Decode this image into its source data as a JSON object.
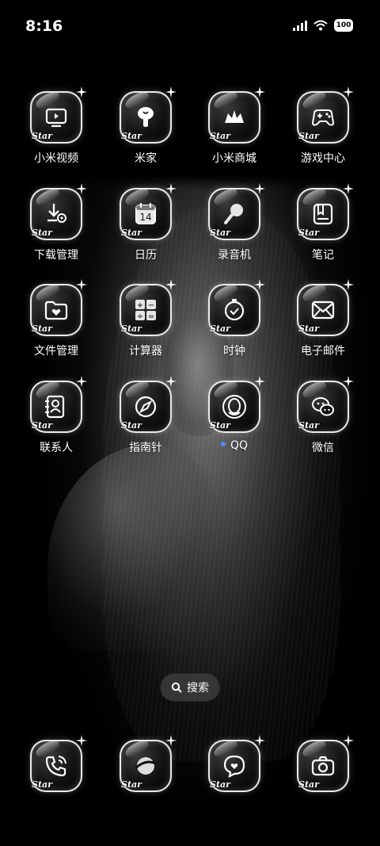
{
  "status": {
    "time": "8:16",
    "battery": "100"
  },
  "apps": [
    {
      "label": "小米视频",
      "icon": "tv-icon"
    },
    {
      "label": "米家",
      "icon": "mijia-icon"
    },
    {
      "label": "小米商城",
      "icon": "shop-icon"
    },
    {
      "label": "游戏中心",
      "icon": "gamepad-icon"
    },
    {
      "label": "下载管理",
      "icon": "download-icon"
    },
    {
      "label": "日历",
      "icon": "calendar-icon",
      "badge": "14"
    },
    {
      "label": "录音机",
      "icon": "microphone-icon"
    },
    {
      "label": "笔记",
      "icon": "note-icon"
    },
    {
      "label": "文件管理",
      "icon": "folder-icon"
    },
    {
      "label": "计算器",
      "icon": "calculator-icon"
    },
    {
      "label": "时钟",
      "icon": "clock-icon"
    },
    {
      "label": "电子邮件",
      "icon": "mail-icon"
    },
    {
      "label": "联系人",
      "icon": "contacts-icon"
    },
    {
      "label": "指南针",
      "icon": "compass-icon"
    },
    {
      "label": "QQ",
      "icon": "qq-icon",
      "new_dot_color": "#4a8cff"
    },
    {
      "label": "微信",
      "icon": "wechat-icon"
    }
  ],
  "icon_overlay_text": "Star",
  "search": {
    "label": "搜索"
  },
  "dock": [
    {
      "icon": "phone-icon"
    },
    {
      "icon": "browser-icon"
    },
    {
      "icon": "message-icon"
    },
    {
      "icon": "camera-icon"
    }
  ]
}
